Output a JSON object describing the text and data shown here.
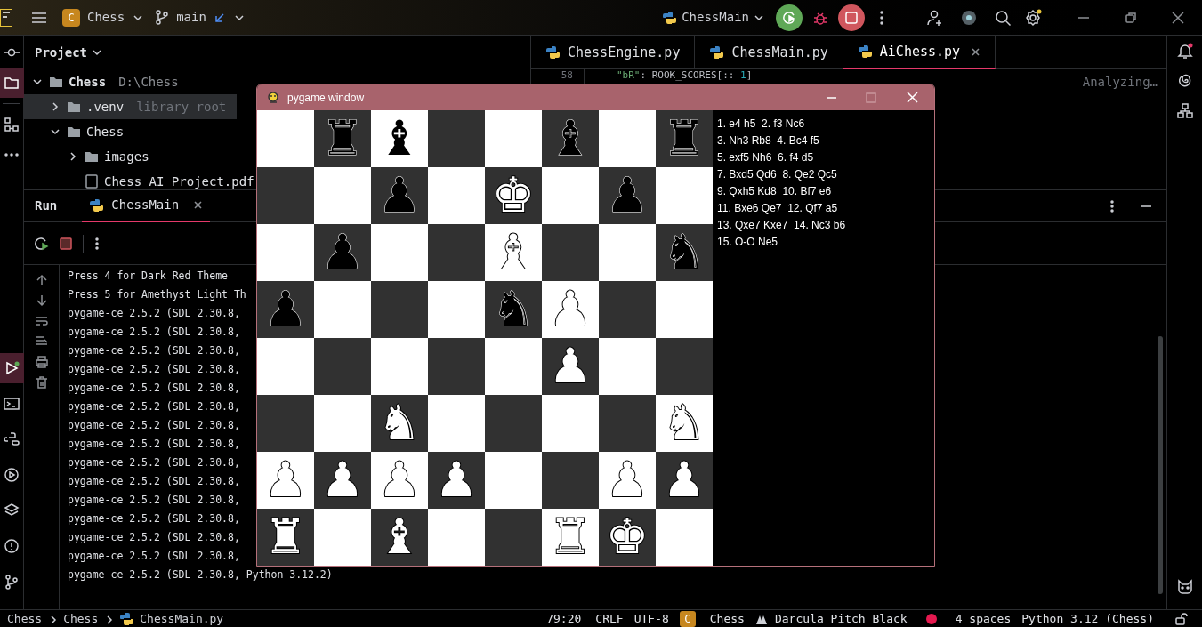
{
  "title_bar": {
    "project_badge": "C",
    "project": "Chess",
    "branch": "main",
    "run_config": "ChessMain"
  },
  "left_toolbar": [
    {
      "kind": "commit",
      "selected": false
    },
    {
      "kind": "folder",
      "selected": true
    },
    {
      "kind": "structure",
      "selected": false
    },
    {
      "kind": "more",
      "selected": false
    }
  ],
  "left_toolbar_bottom": [
    {
      "kind": "run",
      "selected": true
    },
    {
      "kind": "terminal",
      "selected": false
    },
    {
      "kind": "python",
      "selected": false
    },
    {
      "kind": "services",
      "selected": false
    },
    {
      "kind": "layers",
      "selected": false
    },
    {
      "kind": "problems",
      "selected": false
    },
    {
      "kind": "git",
      "selected": false
    }
  ],
  "project_panel": {
    "title": "Project",
    "tree": [
      {
        "kind": "folder",
        "name": "Chess",
        "path": "D:\\Chess",
        "expanded": true,
        "selected": false,
        "children": [
          {
            "kind": "folder",
            "name": ".venv",
            "note": "library root",
            "expanded": false,
            "selected": true
          },
          {
            "kind": "folder",
            "name": "Chess",
            "expanded": true,
            "selected": false,
            "children": [
              {
                "kind": "folder",
                "name": "images",
                "expanded": false,
                "selected": false
              },
              {
                "kind": "file",
                "name": "Chess AI Project.pdf",
                "selected": false
              }
            ]
          }
        ]
      }
    ]
  },
  "editor": {
    "tabs": [
      {
        "label": "ChessEngine.py",
        "selected": false
      },
      {
        "label": "ChessMain.py",
        "selected": false
      },
      {
        "label": "AiChess.py",
        "selected": true
      }
    ],
    "lines": [
      {
        "number": "58",
        "tokens": [
          {
            "kind": "string",
            "text": "\"bR\""
          },
          {
            "kind": "plain",
            "text": ": ROOK_SCORES[::-"
          },
          {
            "kind": "number",
            "text": "1"
          },
          {
            "kind": "plain",
            "text": "]"
          }
        ]
      }
    ],
    "status": "Analyzing…"
  },
  "run_panel": {
    "title": "Run",
    "tabs": [
      {
        "label": "ChessMain",
        "selected": true
      }
    ],
    "console": [
      "Press 4 for Dark Red Theme",
      "Press 5 for Amethyst Light Th",
      "pygame-ce 2.5.2 (SDL 2.30.8,",
      "pygame-ce 2.5.2 (SDL 2.30.8,",
      "pygame-ce 2.5.2 (SDL 2.30.8,",
      "pygame-ce 2.5.2 (SDL 2.30.8,",
      "pygame-ce 2.5.2 (SDL 2.30.8,",
      "pygame-ce 2.5.2 (SDL 2.30.8,",
      "pygame-ce 2.5.2 (SDL 2.30.8,",
      "pygame-ce 2.5.2 (SDL 2.30.8,",
      "pygame-ce 2.5.2 (SDL 2.30.8,",
      "pygame-ce 2.5.2 (SDL 2.30.8,",
      "pygame-ce 2.5.2 (SDL 2.30.8,",
      "pygame-ce 2.5.2 (SDL 2.30.8,",
      "pygame-ce 2.5.2 (SDL 2.30.8,",
      "pygame-ce 2.5.2 (SDL 2.30.8,",
      "pygame-ce 2.5.2 (SDL 2.30.8, Python 3.12.2)"
    ]
  },
  "pygame_window": {
    "title": "pygame window",
    "board": [
      [
        {
          "dark": false
        },
        {
          "dark": true,
          "piece": "♜",
          "white_piece": false
        },
        {
          "dark": false,
          "piece": "♝",
          "white_piece": false
        },
        {
          "dark": true
        },
        {
          "dark": false
        },
        {
          "dark": true,
          "piece": "♝",
          "white_piece": false
        },
        {
          "dark": false
        },
        {
          "dark": true,
          "piece": "♜",
          "white_piece": false
        }
      ],
      [
        {
          "dark": true
        },
        {
          "dark": false
        },
        {
          "dark": true,
          "piece": "♟",
          "white_piece": false
        },
        {
          "dark": false
        },
        {
          "dark": true,
          "piece": "♚",
          "white_piece": true
        },
        {
          "dark": false
        },
        {
          "dark": true,
          "piece": "♟",
          "white_piece": false
        },
        {
          "dark": false
        }
      ],
      [
        {
          "dark": false
        },
        {
          "dark": true,
          "piece": "♟",
          "white_piece": false
        },
        {
          "dark": false
        },
        {
          "dark": true
        },
        {
          "dark": false,
          "piece": "♝",
          "white_piece": true
        },
        {
          "dark": true
        },
        {
          "dark": false
        },
        {
          "dark": true,
          "piece": "♞",
          "white_piece": false
        }
      ],
      [
        {
          "dark": true,
          "piece": "♟",
          "white_piece": false
        },
        {
          "dark": false
        },
        {
          "dark": true
        },
        {
          "dark": false
        },
        {
          "dark": true,
          "piece": "♞",
          "white_piece": false
        },
        {
          "dark": false,
          "piece": "♟",
          "white_piece": true
        },
        {
          "dark": true
        },
        {
          "dark": false
        }
      ],
      [
        {
          "dark": false
        },
        {
          "dark": true
        },
        {
          "dark": false
        },
        {
          "dark": true
        },
        {
          "dark": false
        },
        {
          "dark": true,
          "piece": "♟",
          "white_piece": true
        },
        {
          "dark": false
        },
        {
          "dark": true
        }
      ],
      [
        {
          "dark": true
        },
        {
          "dark": false
        },
        {
          "dark": true,
          "piece": "♞",
          "white_piece": true
        },
        {
          "dark": false
        },
        {
          "dark": true
        },
        {
          "dark": false
        },
        {
          "dark": true
        },
        {
          "dark": false,
          "piece": "♞",
          "white_piece": true
        }
      ],
      [
        {
          "dark": false,
          "piece": "♟",
          "white_piece": true
        },
        {
          "dark": true,
          "piece": "♟",
          "white_piece": true
        },
        {
          "dark": false,
          "piece": "♟",
          "white_piece": true
        },
        {
          "dark": true,
          "piece": "♟",
          "white_piece": true
        },
        {
          "dark": false
        },
        {
          "dark": true
        },
        {
          "dark": false,
          "piece": "♟",
          "white_piece": true
        },
        {
          "dark": true,
          "piece": "♟",
          "white_piece": true
        }
      ],
      [
        {
          "dark": true,
          "piece": "♜",
          "white_piece": true
        },
        {
          "dark": false
        },
        {
          "dark": true,
          "piece": "♝",
          "white_piece": true
        },
        {
          "dark": false
        },
        {
          "dark": true
        },
        {
          "dark": false,
          "piece": "♜",
          "white_piece": true
        },
        {
          "dark": true,
          "piece": "♚",
          "white_piece": true
        },
        {
          "dark": false
        }
      ]
    ],
    "moves": [
      "1. e4 h5  2. f3 Nc6",
      "3. Nh3 Rb8  4. Bc4 f5",
      "5. exf5 Nh6  6. f4 d5",
      "7. Bxd5 Qd6  8. Qe2 Qc5",
      "9. Qxh5 Kd8  10. Bf7 e6",
      "11. Bxe6 Qe7  12. Qf7 a5",
      "13. Qxe7 Kxe7  14. Nc3 b6",
      "15. O-O Ne5"
    ]
  },
  "status_bar": {
    "breadcrumbs": [
      "Chess",
      "Chess",
      "ChessMain.py"
    ],
    "position": "79:20",
    "line_separator": "CRLF",
    "encoding": "UTF-8",
    "project_badge": "C",
    "project": "Chess",
    "theme": "Darcula Pitch Black",
    "indent": "4 spaces",
    "interpreter": "Python 3.12 (Chess)"
  }
}
